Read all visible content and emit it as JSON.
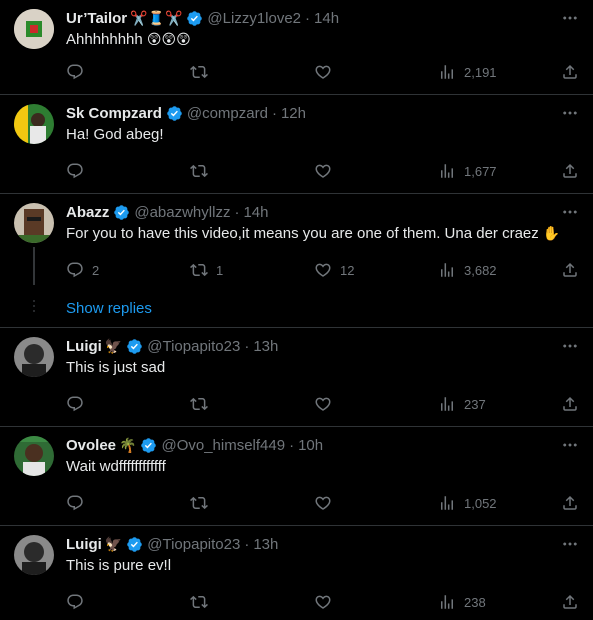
{
  "colors": {
    "background": "#000000",
    "text": "#e7e9ea",
    "muted": "#71767b",
    "accent": "#1d9bf0",
    "divider": "#2f3336"
  },
  "icons": {
    "reply": "reply-icon",
    "retweet": "retweet-icon",
    "like": "like-icon",
    "views": "views-icon",
    "share": "share-icon",
    "more": "more-icon",
    "verified": "verified-icon"
  },
  "tweets": [
    {
      "name": "Ur’Tailor",
      "emoji": "✂️🧵✂️",
      "handle": "@Lizzy1love2",
      "time": "14h",
      "text": "Ahhhhhhhh",
      "text_emoji": "😲😲😲",
      "replies": "",
      "retweets": "",
      "likes": "",
      "views": "2,191"
    },
    {
      "name": "Sk Compzard",
      "emoji": "",
      "handle": "@compzard",
      "time": "12h",
      "text": "Ha! God abeg!",
      "text_emoji": "",
      "replies": "",
      "retweets": "",
      "likes": "",
      "views": "1,677"
    },
    {
      "name": "Abazz",
      "emoji": "",
      "handle": "@abazwhyllzz",
      "time": "14h",
      "text": "For you to have this video,it means you are one of them. Una der craez",
      "text_emoji": "✋",
      "replies": "2",
      "retweets": "1",
      "likes": "12",
      "views": "3,682",
      "show_replies": "Show replies"
    },
    {
      "name": "Luigi",
      "emoji": "🦅",
      "handle": "@Tiopapito23",
      "time": "13h",
      "text": "This is just sad",
      "text_emoji": "",
      "replies": "",
      "retweets": "",
      "likes": "",
      "views": "237"
    },
    {
      "name": "Ovolee",
      "emoji": "🌴",
      "handle": "@Ovo_himself449",
      "time": "10h",
      "text": "Wait wdffffffffffff",
      "text_emoji": "",
      "replies": "",
      "retweets": "",
      "likes": "",
      "views": "1,052"
    },
    {
      "name": "Luigi",
      "emoji": "🦅",
      "handle": "@Tiopapito23",
      "time": "13h",
      "text": "This is pure ev!l",
      "text_emoji": "",
      "replies": "",
      "retweets": "",
      "likes": "",
      "views": "238"
    }
  ]
}
